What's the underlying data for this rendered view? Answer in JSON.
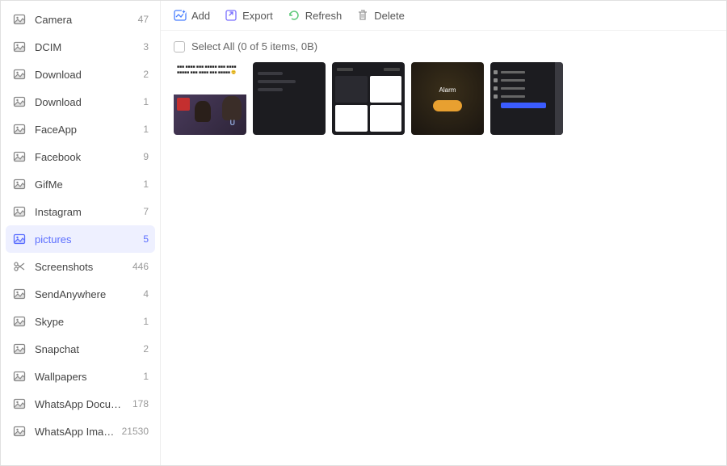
{
  "sidebar": {
    "items": [
      {
        "label": "Camera",
        "count": "47",
        "icon": "image"
      },
      {
        "label": "DCIM",
        "count": "3",
        "icon": "image"
      },
      {
        "label": "Download",
        "count": "2",
        "icon": "image"
      },
      {
        "label": "Download",
        "count": "1",
        "icon": "image"
      },
      {
        "label": "FaceApp",
        "count": "1",
        "icon": "image"
      },
      {
        "label": "Facebook",
        "count": "9",
        "icon": "image"
      },
      {
        "label": "GifMe",
        "count": "1",
        "icon": "image"
      },
      {
        "label": "Instagram",
        "count": "7",
        "icon": "image"
      },
      {
        "label": "pictures",
        "count": "5",
        "icon": "image",
        "active": true
      },
      {
        "label": "Screenshots",
        "count": "446",
        "icon": "scissors"
      },
      {
        "label": "SendAnywhere",
        "count": "4",
        "icon": "image"
      },
      {
        "label": "Skype",
        "count": "1",
        "icon": "image"
      },
      {
        "label": "Snapchat",
        "count": "2",
        "icon": "image"
      },
      {
        "label": "Wallpapers",
        "count": "1",
        "icon": "image"
      },
      {
        "label": "WhatsApp Documents",
        "count": "178",
        "icon": "image"
      },
      {
        "label": "WhatsApp Images",
        "count": "21530",
        "icon": "image"
      }
    ]
  },
  "toolbar": {
    "add": "Add",
    "export": "Export",
    "refresh": "Refresh",
    "delete": "Delete"
  },
  "selectbar": {
    "text": "Select All (0 of 5 items, 0B)"
  },
  "thumbs": {
    "count": 5,
    "alarm_label": "Alarm"
  },
  "colors": {
    "accent": "#5b6eff",
    "add": "#4a7fff",
    "export": "#7a6fff",
    "refresh": "#5fc97a",
    "delete": "#999"
  }
}
